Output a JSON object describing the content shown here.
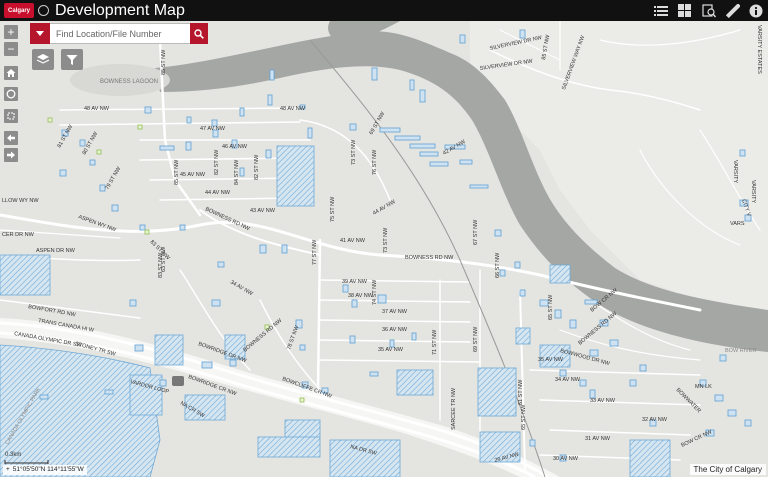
{
  "header": {
    "logo_text": "Calgary",
    "title": "Development Map",
    "icons": [
      "list-icon",
      "grid-icon",
      "search-doc-icon",
      "measure-icon",
      "info-icon"
    ]
  },
  "search": {
    "placeholder": "Find Location/File Number"
  },
  "zoom": {
    "in_label": "+",
    "out_label": "−"
  },
  "labels": {
    "bowness_lagoon": "BOWNESS LAGOON",
    "bow_river": "BOW RIVER",
    "silverview_dr_1": "SILVERVIEW DR NW",
    "silverview_dr_2": "SILVERVIEW DR NW",
    "silverview_way": "SILVERVIEW WAY NW",
    "st_85_top": "85 ST NW",
    "st_85_mid": "85 ST NW",
    "st_85_left": "85 ST NW",
    "st_83": "83 ST NW",
    "st_84": "84 ST NW",
    "st_82_a": "82 ST NW",
    "st_82_b": "82 ST NW",
    "st_81": "81 ST NW",
    "st_80": "80 ST NW",
    "st_79": "79 ST NW",
    "st_78": "78 ST NW",
    "st_77": "77 ST NW",
    "st_76": "76 ST NW",
    "st_75": "75 ST NW",
    "st_74": "74 ST NW",
    "st_73": "73 ST NW",
    "st_71": "71 ST NW",
    "st_69": "69 ST NW",
    "st_67": "67 ST NW",
    "st_66": "66 ST NW",
    "st_65": "65 ST NW",
    "st_63": "63 ST NW",
    "st_83b": "83 ST NW",
    "st_69b": "69 ST NW",
    "st_73b": "73 ST NW",
    "av_48": "48 AV NW",
    "av_48b": "48 AV NW",
    "av_47": "47 AV NW",
    "av_46": "46 AV NW",
    "av_45": "45 AV NW",
    "av_44": "44 AV NW",
    "av_44b": "44 AV NW",
    "av_43": "43 AV NW",
    "av_42": "42 AV NW",
    "av_41": "41 AV NW",
    "av_39": "39 AV NW",
    "av_38": "38 AV NW",
    "av_37": "37 AV NW",
    "av_36": "36 AV NW",
    "av_35": "35 AV NW",
    "av_35b": "35 AV NW",
    "av_34": "34 AV NW",
    "av_34b": "34 AV NW",
    "av_33": "33 AV NW",
    "av_32": "32 AV NW",
    "av_31": "31 AV NW",
    "av_30": "30 AV NW",
    "av_29": "29 AV NW",
    "bowness_rd_1": "BOWNESS RD NW",
    "bowness_rd_2": "BOWNESS RD NW",
    "bowness_rd_3": "BOWNESS RD NW",
    "bowness_rd_4": "BOWNESS RD NW",
    "bow_cr": "BOW CR NW",
    "bow_cr_2": "BOW CR NW",
    "bowwood_dr": "BOWWOOD DR NW",
    "bowwater": "BOWWATER",
    "bowridge_dr": "BOWRIDGE DR NW",
    "bowridge_cr": "BOWRIDGE CR NW",
    "bowcliffe": "BOWCLIFFE CR NW",
    "bow_fort": "BOWFORT RD NW",
    "trans_canada": "TRANS CANADA HI W",
    "stoney_tr": "STONEY TR SW",
    "canada_olympic": "CANADA OLYMPIC DR SW",
    "canada_olympic_2": "CANADA OLYMPIC PARK",
    "aspen_wy": "ASPEN WY NW",
    "aspen_dr": "ASPEN DR NW",
    "cer_dr": "CER DR NW",
    "llow_wy": "LLOW WY NW",
    "varsity_estates": "VARSITY ESTATES",
    "varsity_1": "VARSITY",
    "varsity_2": "VARSITY",
    "varsity_3": "VARS",
    "city_vw": "CITY V",
    "sarcee": "SARCEE TR NW",
    "na_cr": "NA CR SW",
    "na_dr": "NA DR SW",
    "vardor": "VARDOR LOOP",
    "mn_lk": "MN LK",
    "st_61": "61 ST NW",
    "st_65b": "65 ST NW"
  },
  "coords": "51°05'50\"N 114°11'55\"W",
  "scale": "0.3km",
  "attribution": "The City of Calgary",
  "colors": {
    "header": "#111111",
    "accent": "#b5162b",
    "river": "#a3a5a3",
    "land": "#e4e4e1",
    "road": "#ffffff",
    "hatch": "#7fb6dd",
    "parcel": "#8cc2e8"
  }
}
